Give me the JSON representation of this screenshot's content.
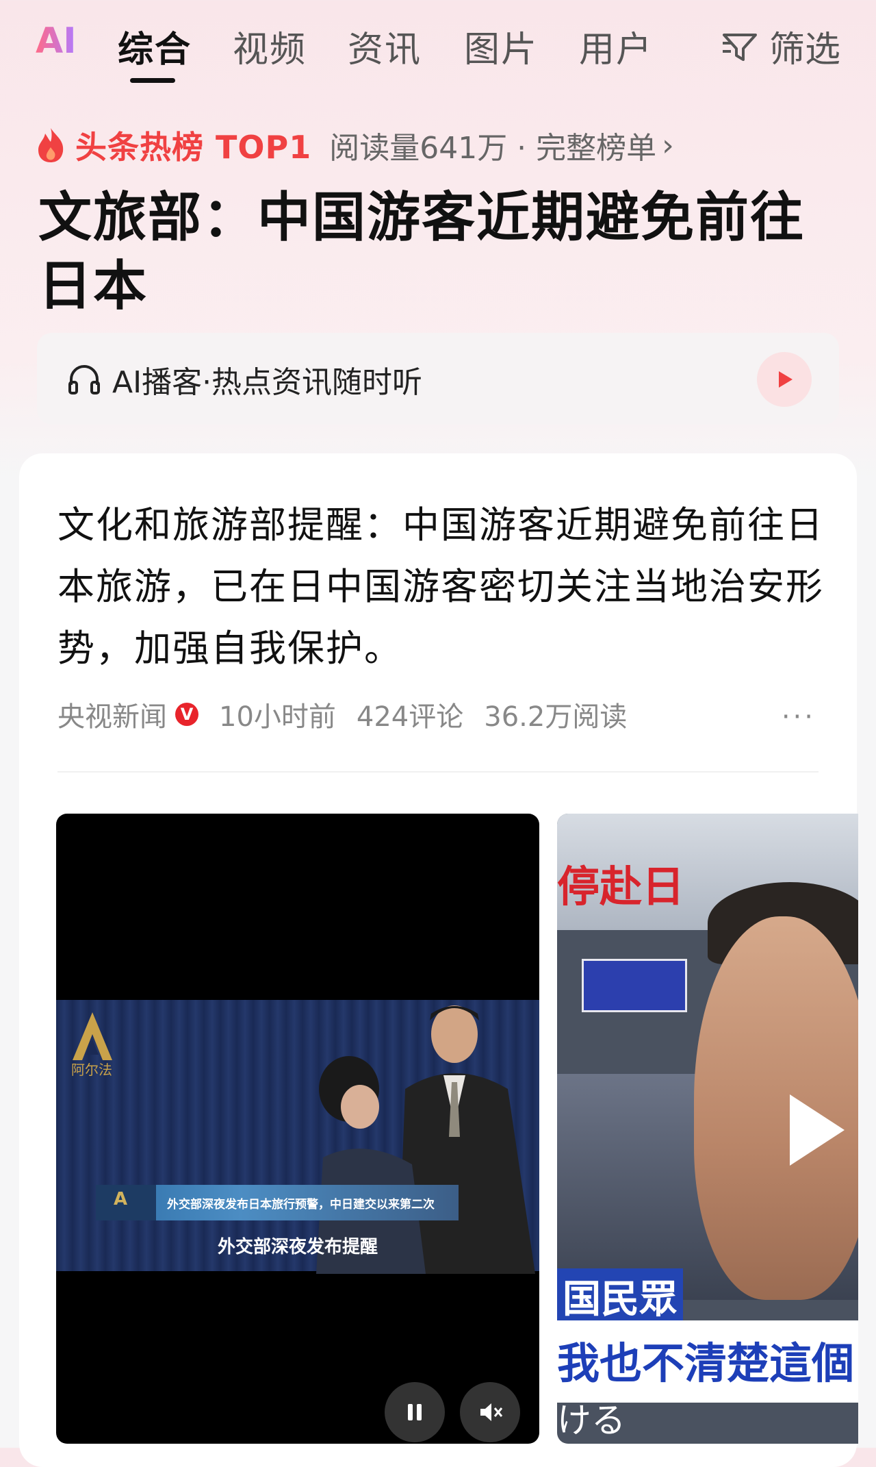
{
  "nav": {
    "logo": "AI",
    "tabs": [
      {
        "label": "综合",
        "active": true
      },
      {
        "label": "视频",
        "active": false
      },
      {
        "label": "资讯",
        "active": false
      },
      {
        "label": "图片",
        "active": false
      },
      {
        "label": "用户",
        "active": false
      }
    ],
    "filter_label": "筛选"
  },
  "hot": {
    "label": "头条热榜 TOP1",
    "read_info": "阅读量641万 · 完整榜单",
    "chevron": "›"
  },
  "headline": "文旅部：中国游客近期避免前往日本",
  "podcast": {
    "label": "AI播客·热点资讯随时听"
  },
  "article": {
    "text": "文化和旅游部提醒：中国游客近期避免前往日本旅游，已在日中国游客密切关注当地治安形势，加强自我保护。",
    "source": "央视新闻",
    "verified_badge": "V",
    "time": "10小时前",
    "comments": "424评论",
    "reads": "36.2万阅读",
    "more": "···"
  },
  "video1": {
    "banner_text": "外交部深夜发布日本旅行预警，中日建交以来第二次",
    "subtitle": "外交部深夜发布提醒",
    "logo_text": "阿尔法"
  },
  "video2": {
    "top_caption": "停赴日",
    "mid_caption": "国民眾",
    "big_caption": "我也不清楚這個",
    "bottom_caption": "ける"
  },
  "colors": {
    "accent_red": "#f04142",
    "background_top": "#f9e6ea"
  }
}
